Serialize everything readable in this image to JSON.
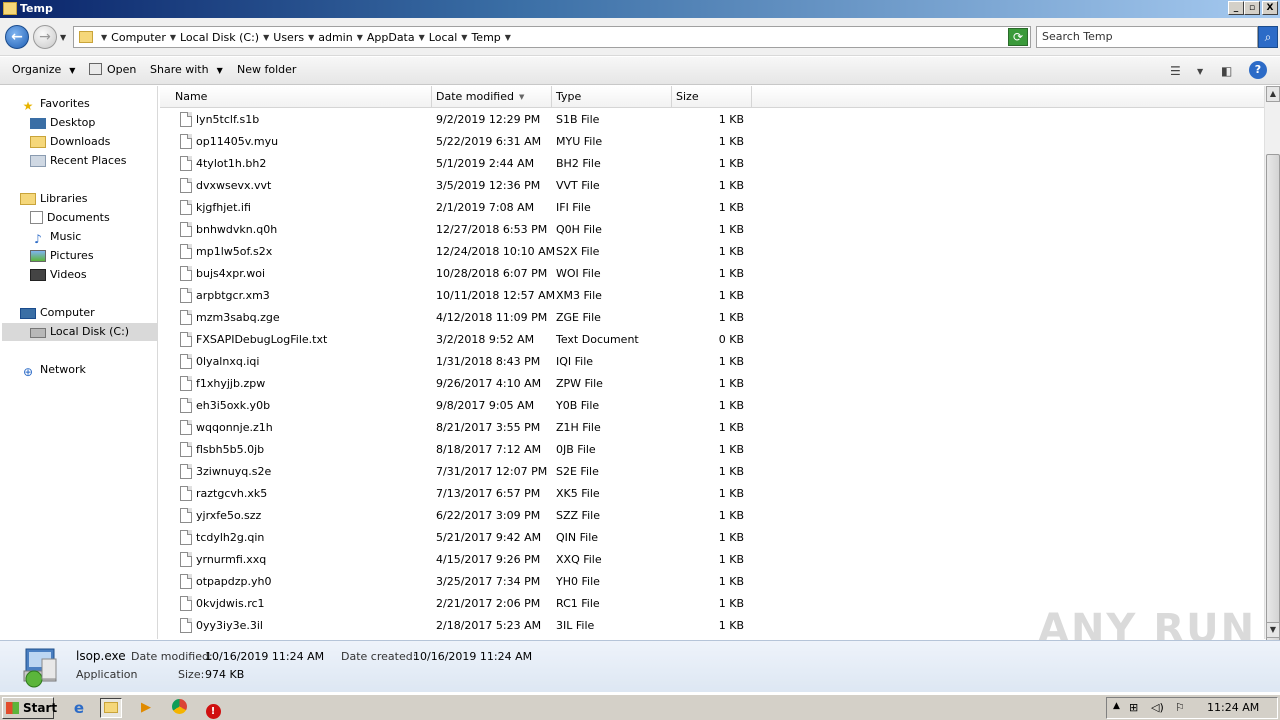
{
  "window": {
    "title": "Temp",
    "min_label": "_",
    "max_label": "▫",
    "close_label": "X"
  },
  "address": {
    "back_glyph": "←",
    "forward_glyph": "→",
    "crumbs": [
      "Computer",
      "Local Disk (C:)",
      "Users",
      "admin",
      "AppData",
      "Local",
      "Temp"
    ],
    "search_placeholder": "Search Temp"
  },
  "toolbar": {
    "organize": "Organize",
    "open": "Open",
    "share_with": "Share with",
    "new_folder": "New folder",
    "help": "?"
  },
  "nav": {
    "favorites": "Favorites",
    "desktop": "Desktop",
    "downloads": "Downloads",
    "recent_places": "Recent Places",
    "libraries": "Libraries",
    "documents": "Documents",
    "music": "Music",
    "pictures": "Pictures",
    "videos": "Videos",
    "computer": "Computer",
    "local_disk": "Local Disk (C:)",
    "network": "Network"
  },
  "columns": {
    "name": "Name",
    "date": "Date modified",
    "type": "Type",
    "size": "Size"
  },
  "files": [
    {
      "name": "lyn5tclf.s1b",
      "date": "9/2/2019 12:29 PM",
      "type": "S1B File",
      "size": "1 KB"
    },
    {
      "name": "op11405v.myu",
      "date": "5/22/2019 6:31 AM",
      "type": "MYU File",
      "size": "1 KB"
    },
    {
      "name": "4tylot1h.bh2",
      "date": "5/1/2019 2:44 AM",
      "type": "BH2 File",
      "size": "1 KB"
    },
    {
      "name": "dvxwsevx.vvt",
      "date": "3/5/2019 12:36 PM",
      "type": "VVT File",
      "size": "1 KB"
    },
    {
      "name": "kjgfhjet.ifi",
      "date": "2/1/2019 7:08 AM",
      "type": "IFI File",
      "size": "1 KB"
    },
    {
      "name": "bnhwdvkn.q0h",
      "date": "12/27/2018 6:53 PM",
      "type": "Q0H File",
      "size": "1 KB"
    },
    {
      "name": "mp1lw5of.s2x",
      "date": "12/24/2018 10:10 AM",
      "type": "S2X File",
      "size": "1 KB"
    },
    {
      "name": "bujs4xpr.woi",
      "date": "10/28/2018 6:07 PM",
      "type": "WOI File",
      "size": "1 KB"
    },
    {
      "name": "arpbtgcr.xm3",
      "date": "10/11/2018 12:57 AM",
      "type": "XM3 File",
      "size": "1 KB"
    },
    {
      "name": "mzm3sabq.zge",
      "date": "4/12/2018 11:09 PM",
      "type": "ZGE File",
      "size": "1 KB"
    },
    {
      "name": "FXSAPIDebugLogFile.txt",
      "date": "3/2/2018 9:52 AM",
      "type": "Text Document",
      "size": "0 KB"
    },
    {
      "name": "0lyalnxq.iqi",
      "date": "1/31/2018 8:43 PM",
      "type": "IQI File",
      "size": "1 KB"
    },
    {
      "name": "f1xhyjjb.zpw",
      "date": "9/26/2017 4:10 AM",
      "type": "ZPW File",
      "size": "1 KB"
    },
    {
      "name": "eh3i5oxk.y0b",
      "date": "9/8/2017 9:05 AM",
      "type": "Y0B File",
      "size": "1 KB"
    },
    {
      "name": "wqqonnje.z1h",
      "date": "8/21/2017 3:55 PM",
      "type": "Z1H File",
      "size": "1 KB"
    },
    {
      "name": "flsbh5b5.0jb",
      "date": "8/18/2017 7:12 AM",
      "type": "0JB File",
      "size": "1 KB"
    },
    {
      "name": "3ziwnuyq.s2e",
      "date": "7/31/2017 12:07 PM",
      "type": "S2E File",
      "size": "1 KB"
    },
    {
      "name": "raztgcvh.xk5",
      "date": "7/13/2017 6:57 PM",
      "type": "XK5 File",
      "size": "1 KB"
    },
    {
      "name": "yjrxfe5o.szz",
      "date": "6/22/2017 3:09 PM",
      "type": "SZZ File",
      "size": "1 KB"
    },
    {
      "name": "tcdylh2g.qin",
      "date": "5/21/2017 9:42 AM",
      "type": "QIN File",
      "size": "1 KB"
    },
    {
      "name": "yrnurmfi.xxq",
      "date": "4/15/2017 9:26 PM",
      "type": "XXQ File",
      "size": "1 KB"
    },
    {
      "name": "otpapdzp.yh0",
      "date": "3/25/2017 7:34 PM",
      "type": "YH0 File",
      "size": "1 KB"
    },
    {
      "name": "0kvjdwis.rc1",
      "date": "2/21/2017 2:06 PM",
      "type": "RC1 File",
      "size": "1 KB"
    },
    {
      "name": "0yy3iy3e.3il",
      "date": "2/18/2017 5:23 AM",
      "type": "3IL File",
      "size": "1 KB"
    }
  ],
  "details": {
    "filename": "lsop.exe",
    "modified_label": "Date modified:",
    "modified_value": "10/16/2019 11:24 AM",
    "created_label": "Date created:",
    "created_value": "10/16/2019 11:24 AM",
    "type": "Application",
    "size_label": "Size:",
    "size_value": "974 KB"
  },
  "watermark": "ANY RUN",
  "taskbar": {
    "start": "Start",
    "clock": "11:24 AM"
  },
  "colors": {
    "selected_bg": "#d9d9d9",
    "details_bg": "#dde7f3",
    "accent_blue": "#2c6bc7"
  }
}
